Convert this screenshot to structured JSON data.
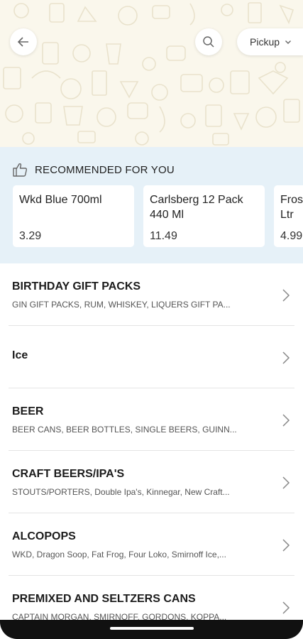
{
  "header": {
    "pickup_label": "Pickup",
    "icons": [
      "back-arrow-icon",
      "search-icon",
      "chevron-down-icon"
    ]
  },
  "recommended": {
    "title": "RECOMMENDED FOR YOU",
    "icon": "thumbs-up-icon",
    "items": [
      {
        "name": "Wkd Blue 700ml",
        "price": "3.29"
      },
      {
        "name": "Carlsberg 12 Pack\n440 Ml",
        "price": "11.49"
      },
      {
        "name": "Fros\nLtr",
        "price": "4.99"
      }
    ]
  },
  "categories": [
    {
      "title": "BIRTHDAY GIFT PACKS",
      "subtitle": "GIN GIFT PACKS, RUM, WHISKEY, LIQUERS GIFT PA..."
    },
    {
      "title": "Ice",
      "subtitle": ""
    },
    {
      "title": "BEER",
      "subtitle": "BEER CANS, BEER BOTTLES, SINGLE BEERS, GUINN..."
    },
    {
      "title": "CRAFT BEERS/IPA'S",
      "subtitle": "STOUTS/PORTERS, Double Ipa's, Kinnegar, New Craft..."
    },
    {
      "title": "ALCOPOPS",
      "subtitle": "WKD, Dragon Soop, Fat Frog, Four Loko, Smirnoff Ice,..."
    },
    {
      "title": "PREMIXED AND SELTZERS CANS",
      "subtitle": "CAPTAIN MORGAN, SMIRNOFF, GORDONS, KOPPA..."
    }
  ],
  "colors": {
    "hero_bg": "#faf7ec",
    "reco_bg": "#e6f1f8",
    "divider": "#e4e4e4"
  }
}
